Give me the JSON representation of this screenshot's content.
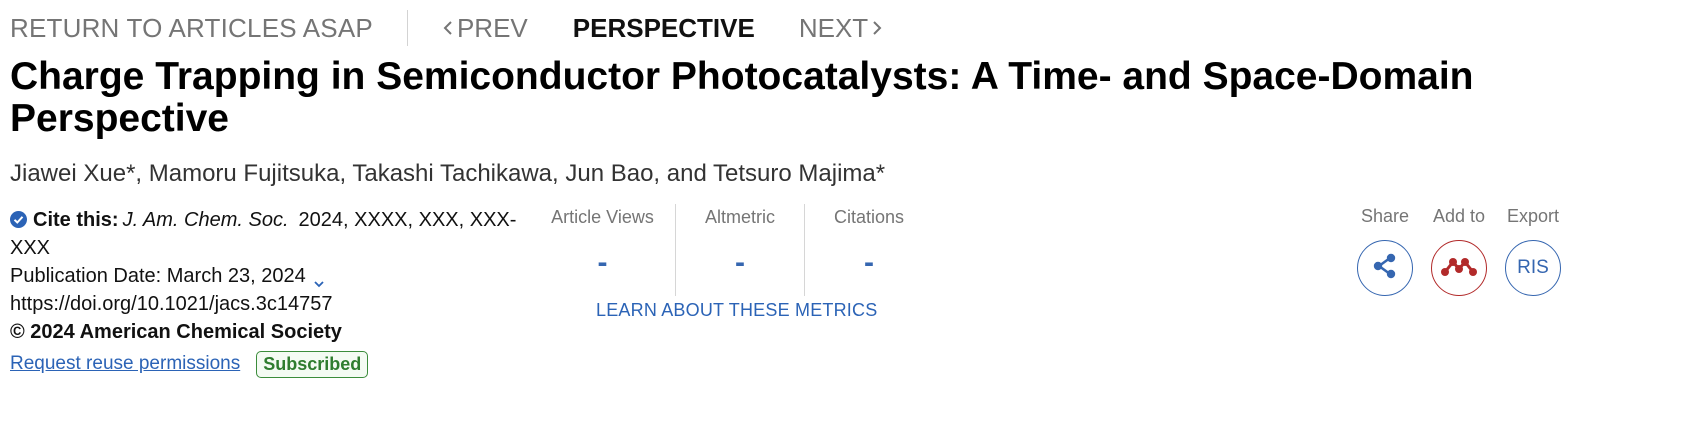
{
  "nav": {
    "return_label": "RETURN TO ARTICLES ASAP",
    "prev_label": "PREV",
    "current_label": "PERSPECTIVE",
    "next_label": "NEXT"
  },
  "article": {
    "title": "Charge Trapping in Semiconductor Photocatalysts: A Time- and Space-Domain Perspective",
    "authors": "Jiawei Xue*, Mamoru Fujitsuka, Takashi Tachikawa, Jun Bao, and Tetsuro Majima*"
  },
  "citation": {
    "cite_label": "Cite this:",
    "journal": "J. Am. Chem. Soc.",
    "year_volume": "2024, XXXX, XXX, XXX-",
    "pages_cont": "XXX",
    "publication_date": "Publication Date: March 23, 2024",
    "doi": "https://doi.org/10.1021/jacs.3c14757",
    "copyright": "© 2024 American Chemical Society",
    "reuse_link": "Request reuse permissions",
    "subscribed_badge": "Subscribed"
  },
  "metrics": {
    "items": [
      {
        "label": "Article Views",
        "value": "-"
      },
      {
        "label": "Altmetric",
        "value": "-"
      },
      {
        "label": "Citations",
        "value": "-"
      }
    ],
    "learn_link": "LEARN ABOUT THESE METRICS"
  },
  "actions": {
    "share_label": "Share",
    "add_label": "Add to",
    "export_label": "Export",
    "ris_label": "RIS"
  },
  "icons": {
    "cite_check": "check-circle-icon",
    "share": "share-icon",
    "mendeley": "mendeley-icon"
  },
  "colors": {
    "link_blue": "#2b63b6",
    "metric_blue": "#3566b0",
    "mendeley_red": "#b22a2a",
    "subscribed_green": "#2f7d2f",
    "muted_gray": "#757575"
  }
}
